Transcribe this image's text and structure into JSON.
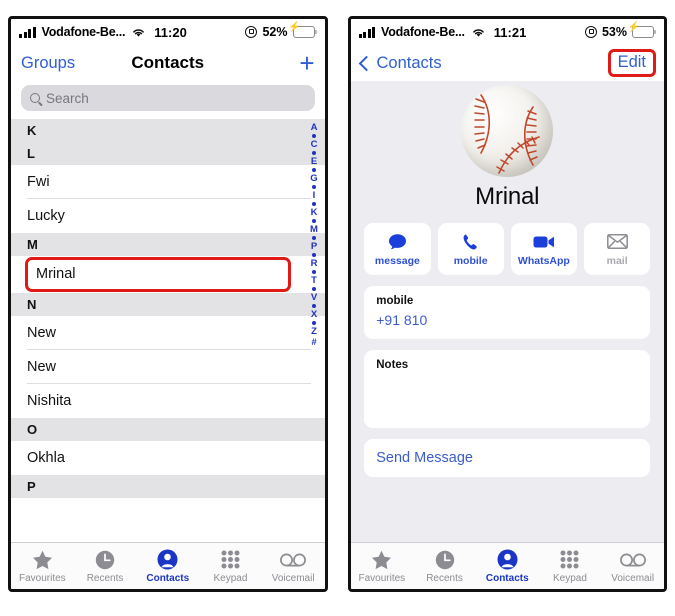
{
  "left_phone": {
    "status_bar": {
      "carrier": "Vodafone-Be...",
      "time": "11:20",
      "battery_percent": "52%",
      "signal_icon": "signal-bars-icon",
      "wifi_icon": "wifi-icon",
      "rotation_lock_icon": "rotation-lock-icon",
      "battery_icon": "battery-charging-icon"
    },
    "nav": {
      "left_label": "Groups",
      "title": "Contacts",
      "add_icon": "plus-icon"
    },
    "search": {
      "placeholder": "Search",
      "icon": "search-icon"
    },
    "list": [
      {
        "type": "section",
        "text": "K"
      },
      {
        "type": "section",
        "text": "L"
      },
      {
        "type": "contact",
        "text": "Fwi",
        "separator": true
      },
      {
        "type": "contact",
        "text": "Lucky",
        "separator": false
      },
      {
        "type": "section",
        "text": "M"
      },
      {
        "type": "contact",
        "text": "Mrinal",
        "selected": true
      },
      {
        "type": "section",
        "text": "N"
      },
      {
        "type": "contact",
        "text": "New",
        "separator": true
      },
      {
        "type": "contact",
        "text": "New",
        "separator": true
      },
      {
        "type": "contact",
        "text": "Nishita",
        "separator": false
      },
      {
        "type": "section",
        "text": "O"
      },
      {
        "type": "contact",
        "text": "Okhla",
        "separator": false
      },
      {
        "type": "section",
        "text": "P"
      }
    ],
    "index_strip": [
      "A",
      "•",
      "C",
      "•",
      "E",
      "•",
      "G",
      "•",
      "I",
      "•",
      "K",
      "•",
      "M",
      "•",
      "P",
      "•",
      "R",
      "•",
      "T",
      "•",
      "V",
      "•",
      "X",
      "•",
      "Z",
      "#"
    ],
    "tabs": [
      {
        "label": "Favourites",
        "icon": "star-icon",
        "active": false
      },
      {
        "label": "Recents",
        "icon": "clock-icon",
        "active": false
      },
      {
        "label": "Contacts",
        "icon": "person-circle-icon",
        "active": true
      },
      {
        "label": "Keypad",
        "icon": "keypad-dots-icon",
        "active": false
      },
      {
        "label": "Voicemail",
        "icon": "voicemail-icon",
        "active": false
      }
    ]
  },
  "right_phone": {
    "status_bar": {
      "carrier": "Vodafone-Be...",
      "time": "11:21",
      "battery_percent": "53%",
      "signal_icon": "signal-bars-icon",
      "wifi_icon": "wifi-icon",
      "rotation_lock_icon": "rotation-lock-icon",
      "battery_icon": "battery-charging-icon"
    },
    "nav": {
      "back_label": "Contacts",
      "back_icon": "chevron-left-icon",
      "edit_label": "Edit"
    },
    "contact": {
      "name": "Mrinal",
      "avatar_icon": "baseball-avatar"
    },
    "actions": [
      {
        "label": "message",
        "icon": "message-bubble-icon",
        "disabled": false
      },
      {
        "label": "mobile",
        "icon": "phone-handset-icon",
        "disabled": false
      },
      {
        "label": "WhatsApp",
        "icon": "video-camera-icon",
        "disabled": false
      },
      {
        "label": "mail",
        "icon": "envelope-icon",
        "disabled": true
      }
    ],
    "phone_card": {
      "label": "mobile",
      "value": "+91 810"
    },
    "notes_card": {
      "label": "Notes"
    },
    "send_message": {
      "label": "Send Message"
    },
    "tabs": [
      {
        "label": "Favourites",
        "icon": "star-icon",
        "active": false
      },
      {
        "label": "Recents",
        "icon": "clock-icon",
        "active": false
      },
      {
        "label": "Contacts",
        "icon": "person-circle-icon",
        "active": true
      },
      {
        "label": "Keypad",
        "icon": "keypad-dots-icon",
        "active": false
      },
      {
        "label": "Voicemail",
        "icon": "voicemail-icon",
        "active": false
      }
    ]
  },
  "annotations": {
    "highlight_color": "#e01a16",
    "accent_color": "#2f5fd0",
    "active_tab_color": "#1b35c4"
  }
}
